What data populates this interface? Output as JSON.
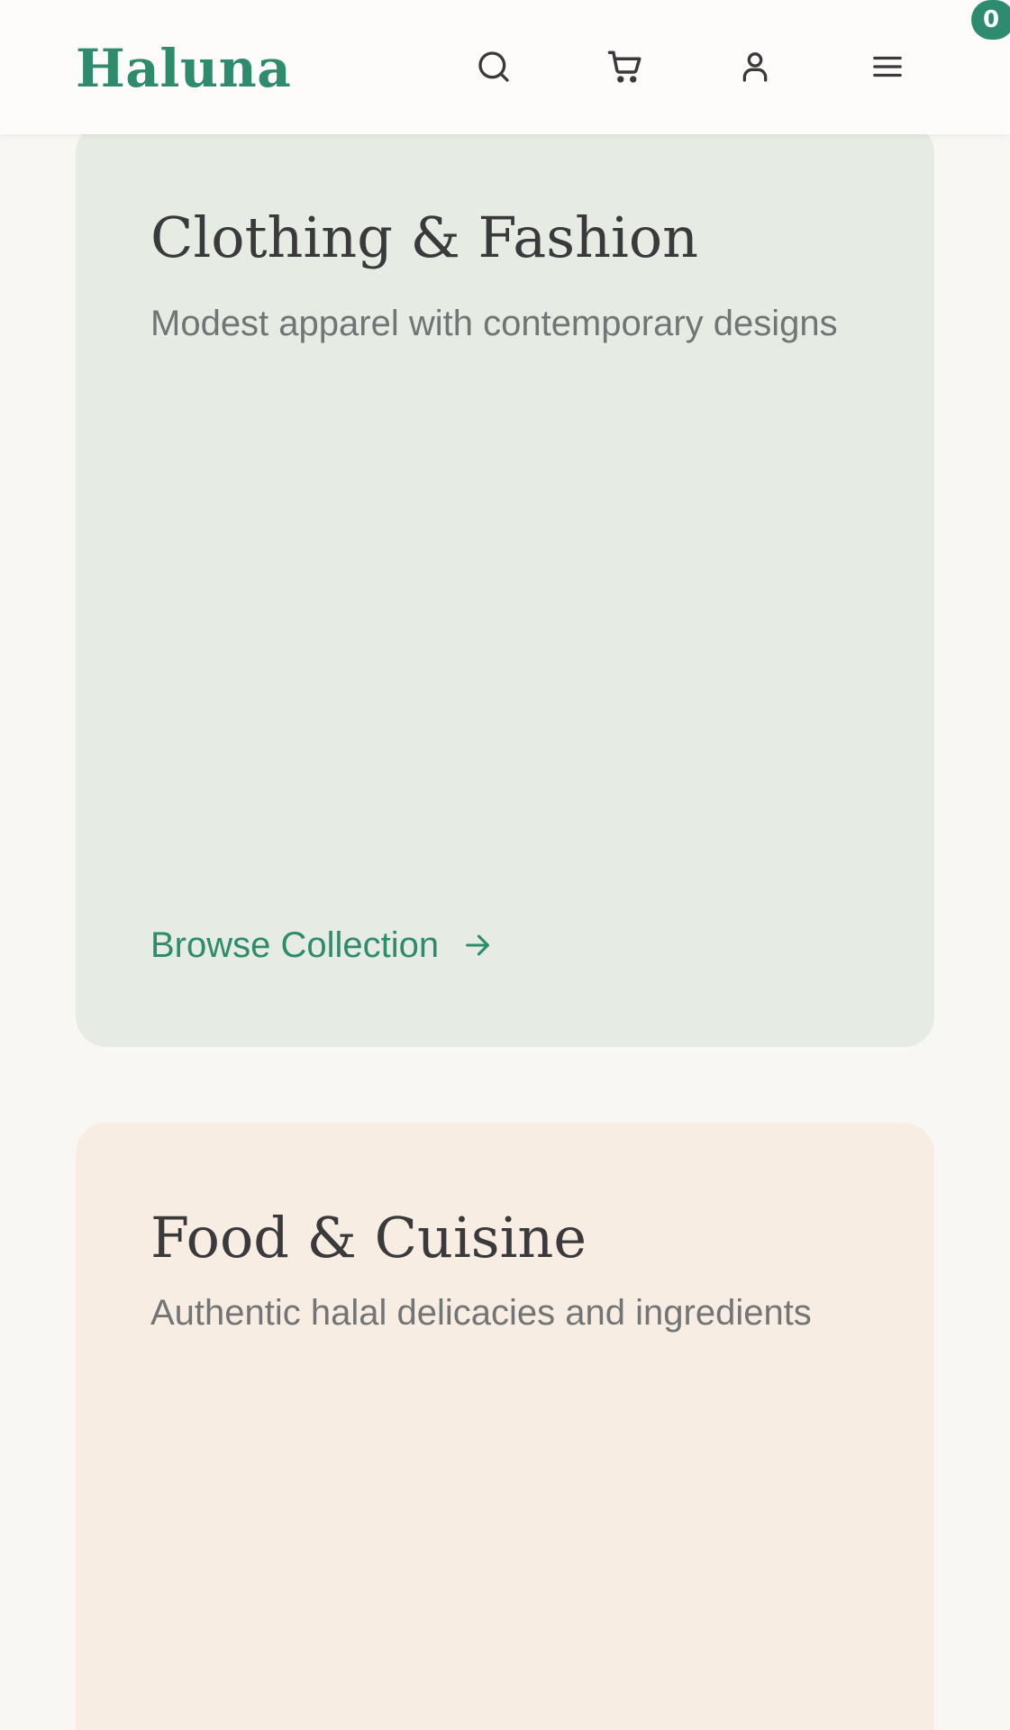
{
  "header": {
    "logo": "Haluna",
    "cart_count": "0",
    "icons": [
      "search-icon",
      "cart-icon",
      "user-icon",
      "menu-icon"
    ]
  },
  "categories": [
    {
      "title": "Clothing & Fashion",
      "description": "Modest apparel with contemporary designs",
      "link_label": "Browse Collection",
      "background": "#e6ece4"
    },
    {
      "title": "Food & Cuisine",
      "description": "Authentic halal delicacies and ingredients",
      "background": "#f8ede2"
    }
  ],
  "colors": {
    "brand": "#2e8b6e",
    "text_dark": "#3a3a3d",
    "text_muted": "#727476",
    "page_background": "#f9f7f3"
  }
}
